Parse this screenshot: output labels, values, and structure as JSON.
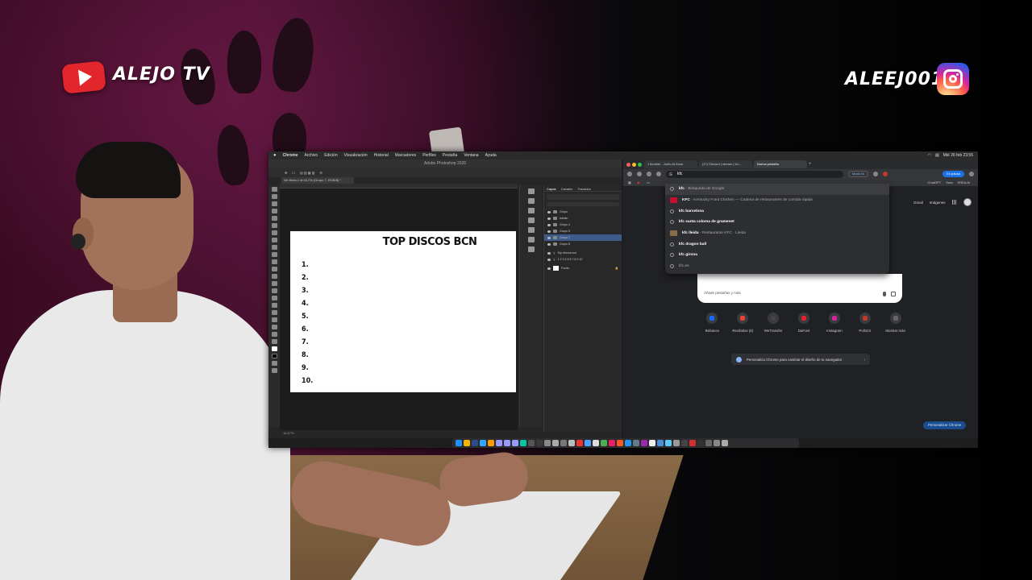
{
  "overlay": {
    "left_brand": "ALEJO TV",
    "right_brand": "ALEEJ0012",
    "youtube_icon": "youtube-icon",
    "instagram_icon": "instagram-icon"
  },
  "mac_menubar": {
    "items": [
      "Chrome",
      "Archivo",
      "Edición",
      "Visualización",
      "Historial",
      "Marcadores",
      "Perfiles",
      "Pestaña",
      "Ventana",
      "Ayuda"
    ],
    "clock": "Mié 26 feb 23:55"
  },
  "photoshop": {
    "window_title": "Adobe Photoshop 2025",
    "doc_tab": "Sin título-1 al 16,7% (Grupo 7, RGB/8) *",
    "zoom_status": "16,67%",
    "artboard": {
      "title": "TOP DISCOS BCN",
      "list": [
        "1.",
        "2.",
        "3.",
        "4.",
        "5.",
        "6.",
        "7.",
        "8.",
        "9.",
        "10."
      ]
    },
    "layers_tabs": [
      "Capas",
      "Canales",
      "Trazados"
    ],
    "layers": [
      {
        "name": "Grupo",
        "selected": false
      },
      {
        "name": "Adrián",
        "selected": false
      },
      {
        "name": "Grupo 4",
        "selected": false
      },
      {
        "name": "Grupo 5",
        "selected": false
      },
      {
        "name": "Grupo 7",
        "selected": true
      },
      {
        "name": "Grupo 8",
        "selected": false
      },
      {
        "name": "Top discos bcn",
        "selected": false
      },
      {
        "name": "1 2 3 4 5 6 7 8 9 10",
        "selected": false
      },
      {
        "name": "Fondo",
        "selected": false
      }
    ]
  },
  "chrome": {
    "tabs": [
      "J Alvarito - Junto Al Amor",
      "(17) Discord | stream | Un...",
      "Nueva pestaña"
    ],
    "omnibox_value": "kfc",
    "modo_ia": "Modo IA",
    "en_pausa": "En pausa",
    "bookmarks_right": [
      "ChatGPT",
      "Sora",
      "KREA AI"
    ],
    "suggestions": [
      {
        "bold": "kfc",
        "rest": " - Búsqueda de Google",
        "icon": "search-icon"
      },
      {
        "bold": "KFC",
        "rest": " - Kentucky Fried Chicken — Cadena de restaurantes de comida rápida",
        "icon": "kfc-logo-icon"
      },
      {
        "bold": "kfc barcelona",
        "rest": "",
        "icon": "search-icon"
      },
      {
        "bold": "kfc santa coloma de gramenet",
        "rest": "",
        "icon": "search-icon"
      },
      {
        "bold": "kfc lleida",
        "rest": " - Restaurante KFC · Lleida",
        "icon": "image-thumb-icon"
      },
      {
        "bold": "kfc dragon ball",
        "rest": "",
        "icon": "search-icon"
      },
      {
        "bold": "kfc girona",
        "rest": "",
        "icon": "search-icon"
      },
      {
        "bold": "",
        "rest": "kfc.es",
        "icon": "globe-icon"
      }
    ],
    "ntp_links": [
      "Gmail",
      "Imágenes"
    ],
    "add_tabs": "Añade pestañas y más",
    "shortcuts": [
      {
        "label": "Behance",
        "color": "#1769ff"
      },
      {
        "label": "Recibidos (6)",
        "color": "#ea4335"
      },
      {
        "label": "WeTransfer",
        "color": "#444444"
      },
      {
        "label": "DaFont",
        "color": "#e0222a"
      },
      {
        "label": "Instagram",
        "color": "#d6249f"
      },
      {
        "label": "Pollo24",
        "color": "#c0392b"
      },
      {
        "label": "Mostrar más",
        "color": "#666666"
      }
    ],
    "customize_banner": "Personaliza Chrome para cambiar el diseño de tu navegador",
    "customize_button": "Personalizar Chrome"
  }
}
